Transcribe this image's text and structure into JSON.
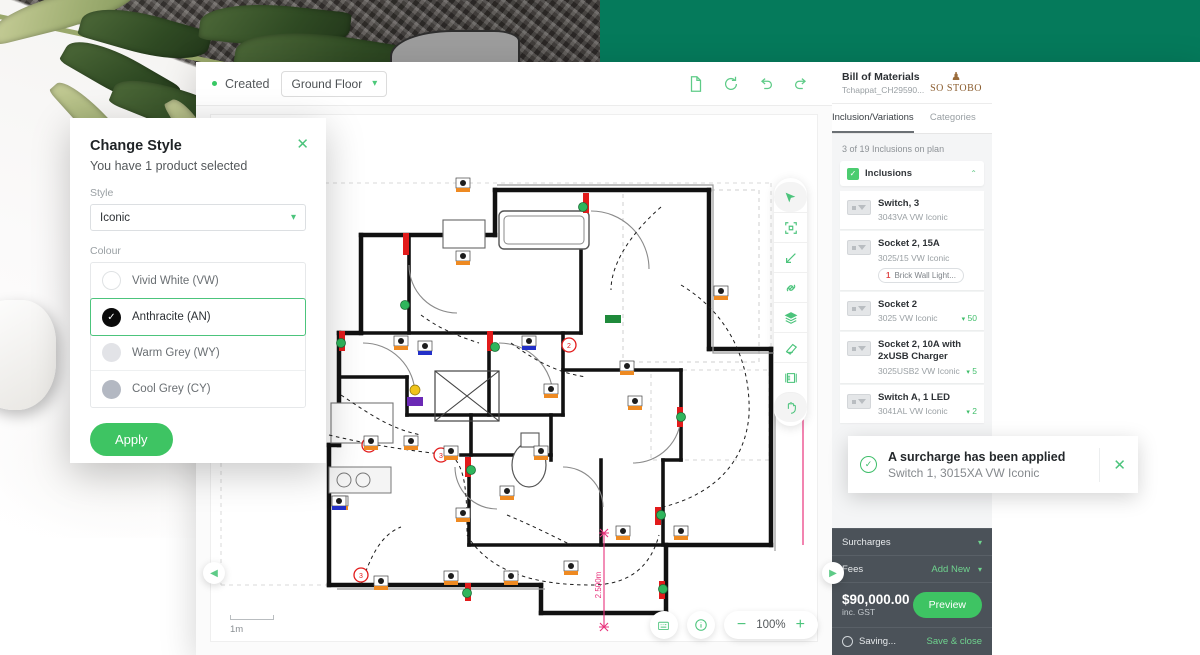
{
  "background": {
    "green_hex": "#057a5b"
  },
  "topbar": {
    "status_label": "Created",
    "floor_value": "Ground Floor",
    "icons": [
      "page-icon",
      "refresh-icon",
      "undo-icon",
      "redo-icon"
    ]
  },
  "canvas": {
    "scale_label": "1m",
    "dimension_label": "2.500m",
    "zoom_level": "100%",
    "zoom_out": "−",
    "zoom_in": "+",
    "tools": [
      {
        "name": "cursor-tool",
        "active": true
      },
      {
        "name": "fit-frame-tool",
        "active": false
      },
      {
        "name": "arrow-tool",
        "active": false
      },
      {
        "name": "link-tool",
        "active": false
      },
      {
        "name": "layers-tool",
        "active": false
      },
      {
        "name": "eraser-tool",
        "active": false
      },
      {
        "name": "measure-tool",
        "active": false
      },
      {
        "name": "pan-tool",
        "active": true
      }
    ]
  },
  "sidebar": {
    "title": "Bill of Materials",
    "subtitle": "Tchappat_CH29590...",
    "logo_mark": "♟",
    "logo_text": "SO STOBO",
    "tabs": [
      {
        "label": "Inclusion/Variations",
        "active": true
      },
      {
        "label": "Categories",
        "active": false
      }
    ],
    "count_text": "3 of 19 Inclusions on plan",
    "group": {
      "label": "Inclusions",
      "checked": true,
      "chevron": "⌃"
    },
    "items": [
      {
        "name": "Switch, 3",
        "code": "3043VA  VW  Iconic",
        "qty": "",
        "tag": ""
      },
      {
        "name": "Socket 2, 15A",
        "code": "3025/15  VW  Iconic",
        "qty": "",
        "tag": "Brick Wall Light...",
        "tag_num": "1"
      },
      {
        "name": "Socket 2",
        "code": "3025  VW  Iconic",
        "qty": "50",
        "tag": ""
      },
      {
        "name": "Socket 2, 10A with 2xUSB Charger",
        "code": "3025USB2  VW  Iconic",
        "qty": "5",
        "tag": ""
      },
      {
        "name": "Switch A, 1 LED",
        "code": "3041AL  VW  Iconic",
        "qty": "2",
        "tag": ""
      }
    ],
    "footer": {
      "surcharges_label": "Surcharges",
      "fees_label": "Fees",
      "add_new_label": "Add New",
      "total_amount": "$90,000.00",
      "total_note": "inc. GST",
      "preview_label": "Preview",
      "saving_label": "Saving...",
      "save_close_label": "Save & close"
    }
  },
  "modal": {
    "title": "Change Style",
    "subtitle": "You have 1 product selected",
    "style_label": "Style",
    "style_value": "Iconic",
    "colour_label": "Colour",
    "colours": [
      {
        "label": "Vivid White (VW)",
        "swatch": "vw",
        "selected": false
      },
      {
        "label": "Anthracite (AN)",
        "swatch": "an",
        "selected": true
      },
      {
        "label": "Warm Grey (WY)",
        "swatch": "wy",
        "selected": false
      },
      {
        "label": "Cool Grey (CY)",
        "swatch": "cy",
        "selected": false
      }
    ],
    "apply_label": "Apply",
    "close_label": "✕"
  },
  "toast": {
    "title": "A surcharge has been applied",
    "subtitle": "Switch 1, 3015XA VW Iconic",
    "check": "✓",
    "close": "✕"
  }
}
